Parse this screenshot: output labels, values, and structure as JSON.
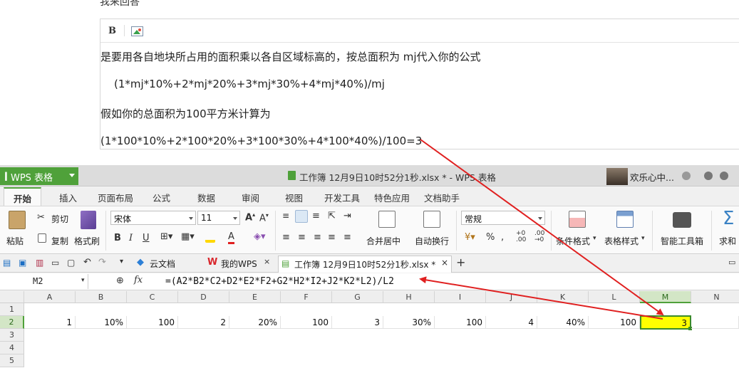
{
  "answer": {
    "heading": "我来回答",
    "toolbar_bold": "B",
    "lines": [
      "是要用各自地块所占用的面积乘以各自区域标高的，按总面积为 mj代入你的公式",
      "(1*mj*10%+2*mj*20%+3*mj*30%+4*mj*40%)/mj",
      "假如你的总面积为100平方米计算为",
      "(1*100*10%+2*100*20%+3*100*30%+4*100*40%)/100=3"
    ]
  },
  "window": {
    "app_name": "WPS 表格",
    "title": "工作簿 12月9日10时52分1秒.xlsx * - WPS 表格",
    "user": "欢乐心中..."
  },
  "menu_tabs": [
    "开始",
    "插入",
    "页面布局",
    "公式",
    "数据",
    "审阅",
    "视图",
    "开发工具",
    "特色应用",
    "文档助手"
  ],
  "ribbon": {
    "paste": "粘贴",
    "cut": "剪切",
    "copy": "复制",
    "format_painter": "格式刷",
    "font_name": "宋体",
    "font_size": "11",
    "merge_center": "合并居中",
    "wrap_text": "自动换行",
    "number_format": "常规",
    "percent": "%",
    "conditional_format": "条件格式",
    "table_style": "表格样式",
    "smart_toolbox": "智能工具箱",
    "sum": "求和"
  },
  "doc_tabs": {
    "cloud": "云文档",
    "my_wps": "我的WPS",
    "workbook": "工作簿 12月9日10时52分1秒.xlsx *"
  },
  "formula_bar": {
    "name_box": "M2",
    "fx": "fx",
    "formula": "=(A2*B2*C2+D2*E2*F2+G2*H2*I2+J2*K2*L2)/L2"
  },
  "sheet": {
    "columns": [
      "A",
      "B",
      "C",
      "D",
      "E",
      "F",
      "G",
      "H",
      "I",
      "J",
      "K",
      "L",
      "M",
      "N"
    ],
    "rows": [
      "1",
      "2",
      "3",
      "4",
      "5"
    ],
    "row2": [
      "1",
      "10%",
      "100",
      "2",
      "20%",
      "100",
      "3",
      "30%",
      "100",
      "4",
      "40%",
      "100",
      "3",
      ""
    ]
  },
  "colors": {
    "wps_green": "#4fa13a",
    "highlight_cell": "#ffff00",
    "arrow_red": "#e02020"
  }
}
